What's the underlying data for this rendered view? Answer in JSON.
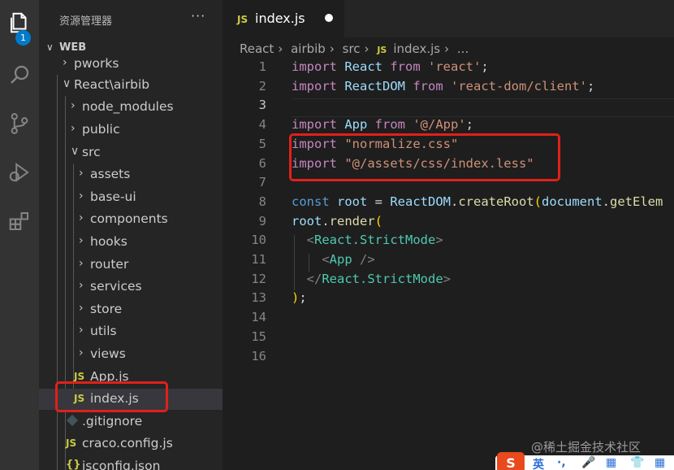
{
  "activity_bar": {
    "explorer_badge": "1",
    "icons": [
      "files-icon",
      "search-icon",
      "source-control-icon",
      "run-debug-icon",
      "extensions-icon"
    ]
  },
  "sidebar": {
    "title": "资源管理器",
    "more": "···",
    "section": "WEB",
    "items": [
      {
        "label": "pworks",
        "type": "folder",
        "expanded": false
      },
      {
        "label": "React\\airbib",
        "type": "folder",
        "expanded": true
      },
      {
        "label": "node_modules",
        "type": "folder",
        "expanded": false
      },
      {
        "label": "public",
        "type": "folder",
        "expanded": false
      },
      {
        "label": "src",
        "type": "folder",
        "expanded": true
      },
      {
        "label": "assets",
        "type": "folder",
        "expanded": false
      },
      {
        "label": "base-ui",
        "type": "folder",
        "expanded": false
      },
      {
        "label": "components",
        "type": "folder",
        "expanded": false
      },
      {
        "label": "hooks",
        "type": "folder",
        "expanded": false
      },
      {
        "label": "router",
        "type": "folder",
        "expanded": false
      },
      {
        "label": "services",
        "type": "folder",
        "expanded": false
      },
      {
        "label": "store",
        "type": "folder",
        "expanded": false
      },
      {
        "label": "utils",
        "type": "folder",
        "expanded": false
      },
      {
        "label": "views",
        "type": "folder",
        "expanded": false
      },
      {
        "label": "App.js",
        "type": "js"
      },
      {
        "label": "index.js",
        "type": "js",
        "selected": true
      },
      {
        "label": ".gitignore",
        "type": "git"
      },
      {
        "label": "craco.config.js",
        "type": "js"
      },
      {
        "label": "jsconfig.json",
        "type": "json"
      }
    ],
    "js_badge": "JS"
  },
  "tab": {
    "badge": "JS",
    "name": "index.js"
  },
  "breadcrumb": {
    "parts": [
      "React",
      "airbib",
      "src"
    ],
    "badge": "JS",
    "file": "index.js",
    "tail": "..."
  },
  "editor": {
    "line_numbers": [
      "1",
      "2",
      "3",
      "4",
      "5",
      "6",
      "7",
      "8",
      "9",
      "10",
      "11",
      "12",
      "13",
      "14",
      "15",
      "16"
    ],
    "active_line": "3",
    "lines": [
      [
        {
          "t": "import",
          "c": "kw"
        },
        {
          "t": " React ",
          "c": "id"
        },
        {
          "t": "from",
          "c": "kw"
        },
        {
          "t": " ",
          "c": ""
        },
        {
          "t": "'react'",
          "c": "str"
        },
        {
          "t": ";",
          "c": ""
        }
      ],
      [
        {
          "t": "import",
          "c": "kw"
        },
        {
          "t": " ReactDOM ",
          "c": "id"
        },
        {
          "t": "from",
          "c": "kw"
        },
        {
          "t": " ",
          "c": ""
        },
        {
          "t": "'react-dom/client'",
          "c": "str"
        },
        {
          "t": ";",
          "c": ""
        }
      ],
      [],
      [
        {
          "t": "import",
          "c": "kw"
        },
        {
          "t": " App ",
          "c": "id"
        },
        {
          "t": "from",
          "c": "kw"
        },
        {
          "t": " ",
          "c": ""
        },
        {
          "t": "'@/App'",
          "c": "str"
        },
        {
          "t": ";",
          "c": ""
        }
      ],
      [
        {
          "t": "import",
          "c": "kw"
        },
        {
          "t": " ",
          "c": ""
        },
        {
          "t": "\"normalize.css\"",
          "c": "str"
        }
      ],
      [
        {
          "t": "import",
          "c": "kw"
        },
        {
          "t": " ",
          "c": ""
        },
        {
          "t": "\"@/assets/css/index.less\"",
          "c": "str"
        }
      ],
      [],
      [
        {
          "t": "const",
          "c": "kw2"
        },
        {
          "t": " ",
          "c": ""
        },
        {
          "t": "root",
          "c": "id"
        },
        {
          "t": " = ",
          "c": ""
        },
        {
          "t": "ReactDOM",
          "c": "id"
        },
        {
          "t": ".",
          "c": ""
        },
        {
          "t": "createRoot",
          "c": "fn"
        },
        {
          "t": "(",
          "c": "brk"
        },
        {
          "t": "document",
          "c": "id"
        },
        {
          "t": ".",
          "c": ""
        },
        {
          "t": "getElem",
          "c": "fn"
        }
      ],
      [
        {
          "t": "root",
          "c": "id"
        },
        {
          "t": ".",
          "c": ""
        },
        {
          "t": "render",
          "c": "fn"
        },
        {
          "t": "(",
          "c": "brk"
        }
      ],
      [
        {
          "t": "  ",
          "c": ""
        },
        {
          "t": "<",
          "c": "punc"
        },
        {
          "t": "React.StrictMode",
          "c": "tag"
        },
        {
          "t": ">",
          "c": "punc"
        }
      ],
      [
        {
          "t": "    ",
          "c": ""
        },
        {
          "t": "<",
          "c": "punc"
        },
        {
          "t": "App",
          "c": "tag"
        },
        {
          "t": " />",
          "c": "punc"
        }
      ],
      [
        {
          "t": "  ",
          "c": ""
        },
        {
          "t": "</",
          "c": "punc"
        },
        {
          "t": "React.StrictMode",
          "c": "tag"
        },
        {
          "t": ">",
          "c": "punc"
        }
      ],
      [
        {
          "t": ")",
          "c": "brk"
        },
        {
          "t": ";",
          "c": ""
        }
      ],
      [],
      [],
      []
    ]
  },
  "watermark": "@稀土掘金技术社区",
  "ime": {
    "logo": "S",
    "items": [
      "英",
      "·,",
      "🎤",
      "▦",
      "👕",
      "▦"
    ]
  },
  "colors": {
    "highlight_box": "#e0201a",
    "accent": "#007acc"
  }
}
